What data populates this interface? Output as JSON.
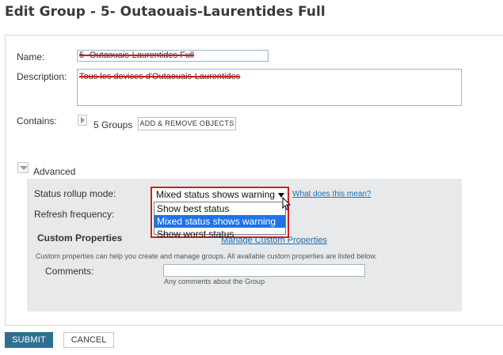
{
  "page": {
    "title": "Edit Group - 5- Outaouais-Laurentides Full"
  },
  "form": {
    "name_label": "Name:",
    "name_value": "5- Outaouais-Laurentides Full",
    "description_label": "Description:",
    "description_value": "Tous les devices d'Outaouais-Laurentides",
    "contains_label": "Contains:",
    "contains_count": "5 Groups",
    "add_remove_label": "ADD & REMOVE OBJECTS"
  },
  "advanced": {
    "label": "Advanced",
    "status_rollup_label": "Status rollup mode:",
    "status_rollup_selected": "Mixed status shows warning",
    "status_rollup_options": [
      "Show best status",
      "Mixed status shows warning",
      "Show worst status"
    ],
    "help_link": "What does this mean?",
    "refresh_label": "Refresh frequency:",
    "custom_props_title": "Custom Properties",
    "manage_link": "Manage Custom Properties",
    "custom_props_desc": "Custom properties can help you create and manage groups. All available custom properties are listed below.",
    "comments_label": "Comments:",
    "comments_value": "",
    "comments_help": "Any comments about the Group"
  },
  "actions": {
    "submit": "SUBMIT",
    "cancel": "CANCEL"
  },
  "colors": {
    "accent": "#2f6f93",
    "link": "#1b6fb2",
    "highlight": "#1e73e8",
    "annotation": "#d21f1f"
  }
}
